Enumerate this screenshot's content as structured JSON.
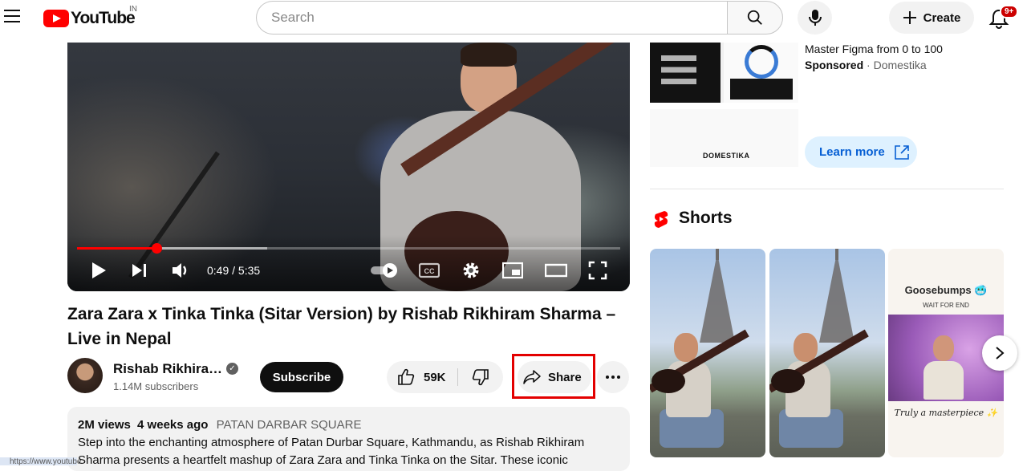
{
  "header": {
    "logo_text": "YouTube",
    "country": "IN",
    "search_placeholder": "Search",
    "create_label": "Create",
    "notification_count": "9+"
  },
  "player": {
    "time": "0:49 / 5:35",
    "progress_fraction": 0.146,
    "buffered_fraction": 0.35
  },
  "video": {
    "title": "Zara Zara x Tinka Tinka (Sitar Version) by Rishab Rikhiram Sharma – Live in Nepal",
    "channel_name": "Rishab Rikhira…",
    "subscribers": "1.14M subscribers",
    "subscribe_label": "Subscribe",
    "likes": "59K",
    "share_label": "Share"
  },
  "description": {
    "views": "2M views",
    "age": "4 weeks ago",
    "location": "PATAN DARBAR SQUARE",
    "line1": "Step into the enchanting atmosphere of Patan Durbar Square, Kathmandu, as Rishab Rikhiram",
    "line2": "Sharma presents a heartfelt mashup of Zara Zara and Tinka Tinka on the Sitar. These iconic"
  },
  "status_bar": {
    "url": "https://www.youtube"
  },
  "ad": {
    "title": "Master Figma from 0 to 100",
    "sponsored_label": "Sponsored",
    "advertiser": "Domestika",
    "logo_text": "DOMESTIKA",
    "cta_label": "Learn more"
  },
  "shorts": {
    "heading": "Shorts",
    "items": [
      {
        "kind": "eiffel"
      },
      {
        "kind": "eiffel"
      },
      {
        "title": "Goosebumps 🥶",
        "subtitle": "WAIT FOR END",
        "caption": "Truly a masterpiece ✨"
      }
    ]
  },
  "colors": {
    "brand_red": "#ff0000",
    "link_blue": "#065fd4",
    "highlight_red": "#e30000"
  }
}
